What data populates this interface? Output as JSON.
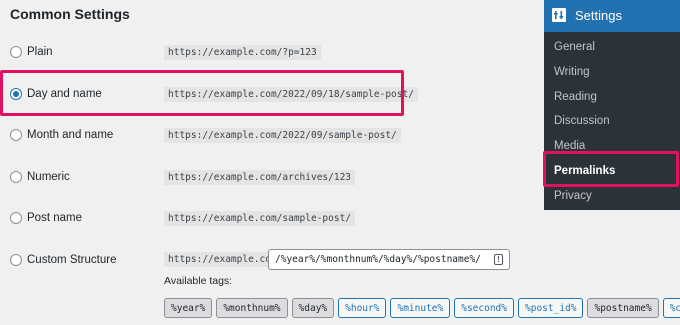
{
  "section_title": "Common Settings",
  "options": [
    {
      "label": "Plain",
      "code": "https://example.com/?p=123",
      "checked": false
    },
    {
      "label": "Day and name",
      "code": "https://example.com/2022/09/18/sample-post/",
      "checked": true
    },
    {
      "label": "Month and name",
      "code": "https://example.com/2022/09/sample-post/",
      "checked": false
    },
    {
      "label": "Numeric",
      "code": "https://example.com/archives/123",
      "checked": false
    },
    {
      "label": "Post name",
      "code": "https://example.com/sample-post/",
      "checked": false
    }
  ],
  "custom": {
    "label": "Custom Structure",
    "base_url": "https://example.com",
    "value": "/%year%/%monthnum%/%day%/%postname%/",
    "info_icon": "!"
  },
  "available_tags_label": "Available tags:",
  "tags": [
    {
      "text": "%year%",
      "active": true
    },
    {
      "text": "%monthnum%",
      "active": true
    },
    {
      "text": "%day%",
      "active": true
    },
    {
      "text": "%hour%",
      "active": false
    },
    {
      "text": "%minute%",
      "active": false
    },
    {
      "text": "%second%",
      "active": false
    },
    {
      "text": "%post_id%",
      "active": false
    },
    {
      "text": "%postname%",
      "active": true
    },
    {
      "text": "%cate",
      "active": false
    }
  ],
  "sidebar": {
    "header_icon": "settings-icon",
    "header_label": "Settings",
    "items": [
      {
        "label": "General",
        "current": false
      },
      {
        "label": "Writing",
        "current": false
      },
      {
        "label": "Reading",
        "current": false
      },
      {
        "label": "Discussion",
        "current": false
      },
      {
        "label": "Media",
        "current": false
      },
      {
        "label": "Permalinks",
        "current": true
      },
      {
        "label": "Privacy",
        "current": false
      }
    ]
  },
  "colors": {
    "accent": "#2271b1",
    "highlight": "#e0115f",
    "sidebar_bg": "#2c3338"
  }
}
